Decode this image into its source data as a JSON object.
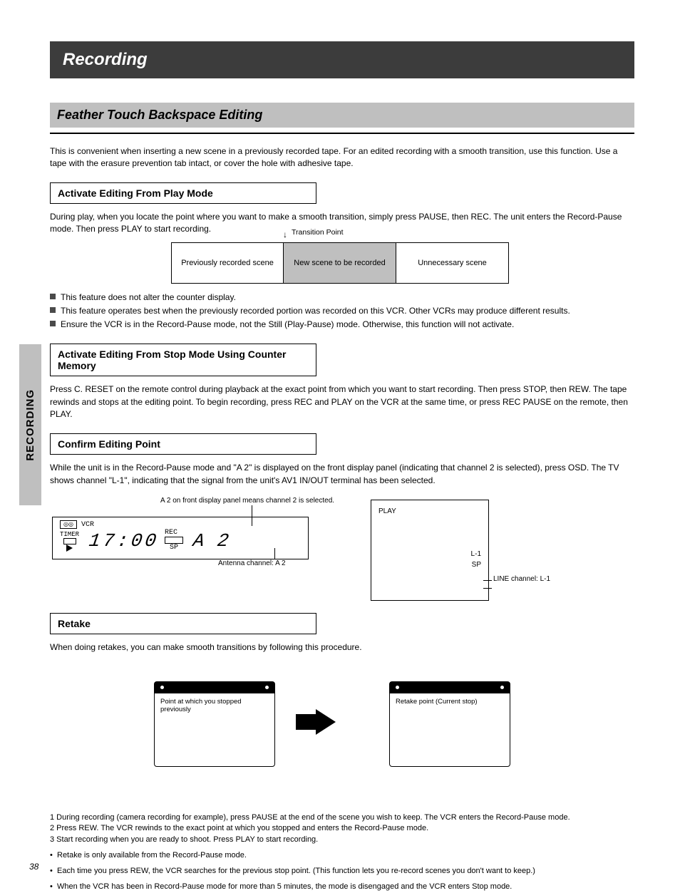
{
  "side_tab": "RECORDING",
  "page_number": "38",
  "header": {
    "title": "Recording"
  },
  "subheader": {
    "title": "Feather Touch Backspace Editing"
  },
  "intro": "This is convenient when inserting a new scene in a previously recorded tape. For an edited recording with a smooth transition, use this function. Use a tape with the erasure prevention tab intact, or cover the hole with adhesive tape.",
  "sections": {
    "activate": {
      "title": "Activate Editing From Play Mode",
      "para": "During play, when you locate the point where you want to make a smooth transition, simply press PAUSE, then REC. The unit enters the Record-Pause mode. Then press PLAY to start recording."
    },
    "memory": {
      "title": "Activate Editing From Stop Mode Using Counter Memory",
      "para": "Press C. RESET on the remote control during playback at the exact point from which you want to start recording. Then press STOP, then REW. The tape rewinds and stops at the editing point. To begin recording, press REC and PLAY on the VCR at the same time, or press REC PAUSE on the remote, then PLAY."
    },
    "confirm": {
      "title": "Confirm Editing Point",
      "para": "While the unit is in the Record-Pause mode and \"A 2\" is displayed on the front display panel (indicating that channel 2 is selected), press OSD. The TV shows channel \"L-1\", indicating that the signal from the unit's AV1 IN/OUT terminal has been selected."
    },
    "retake": {
      "title": "Retake",
      "para": "When doing retakes, you can make smooth transitions by following this procedure."
    }
  },
  "tape": {
    "arrow_label": "Transition Point",
    "left": "Previously recorded scene",
    "mid": "New scene to be recorded",
    "right": "Unnecessary scene"
  },
  "bullets": {
    "b1": "This feature does not alter the counter display.",
    "b2": "This feature operates best when the previously recorded portion was recorded on this VCR. Other VCRs may produce different results.",
    "b3": "Ensure the VCR is in the Record-Pause mode, not the Still (Play-Pause) mode. Otherwise, this function will not activate."
  },
  "vcr_display": {
    "callout_top": "A 2 on front display panel means channel 2 is selected.",
    "tape_icon": "◎◎",
    "vcr_word": "VCR",
    "timer_word": "TIMER",
    "rec_word": "REC",
    "seg_time": "17:00",
    "sp_word": "SP",
    "seg_a": "A",
    "seg_num": "2",
    "callout_bot": "Antenna channel: A 2"
  },
  "tv_display": {
    "line1": "PLAY",
    "line2": "L-1",
    "line3": "SP",
    "callout": "LINE channel: L-1"
  },
  "cassette": {
    "left_label": "Point at which you stopped previously",
    "right_label": "Retake point (Current stop)"
  },
  "footnotes": {
    "lead_a": "1 During recording (camera recording for example), press PAUSE at the end of the scene you wish to keep. The VCR enters the Record-Pause mode.",
    "lead_b": "2 Press REW. The VCR rewinds to the exact point at which you stopped and enters the Record-Pause mode.",
    "lead_c": "3 Start recording when you are ready to shoot. Press PLAY to start recording.",
    "n1": "Retake is only available from the Record-Pause mode.",
    "n2": "Each time you press REW, the VCR searches for the previous stop point. (This function lets you re-record scenes you don't want to keep.)",
    "n3": "When the VCR has been in Record-Pause mode for more than 5 minutes, the mode is disengaged and the VCR enters Stop mode."
  }
}
